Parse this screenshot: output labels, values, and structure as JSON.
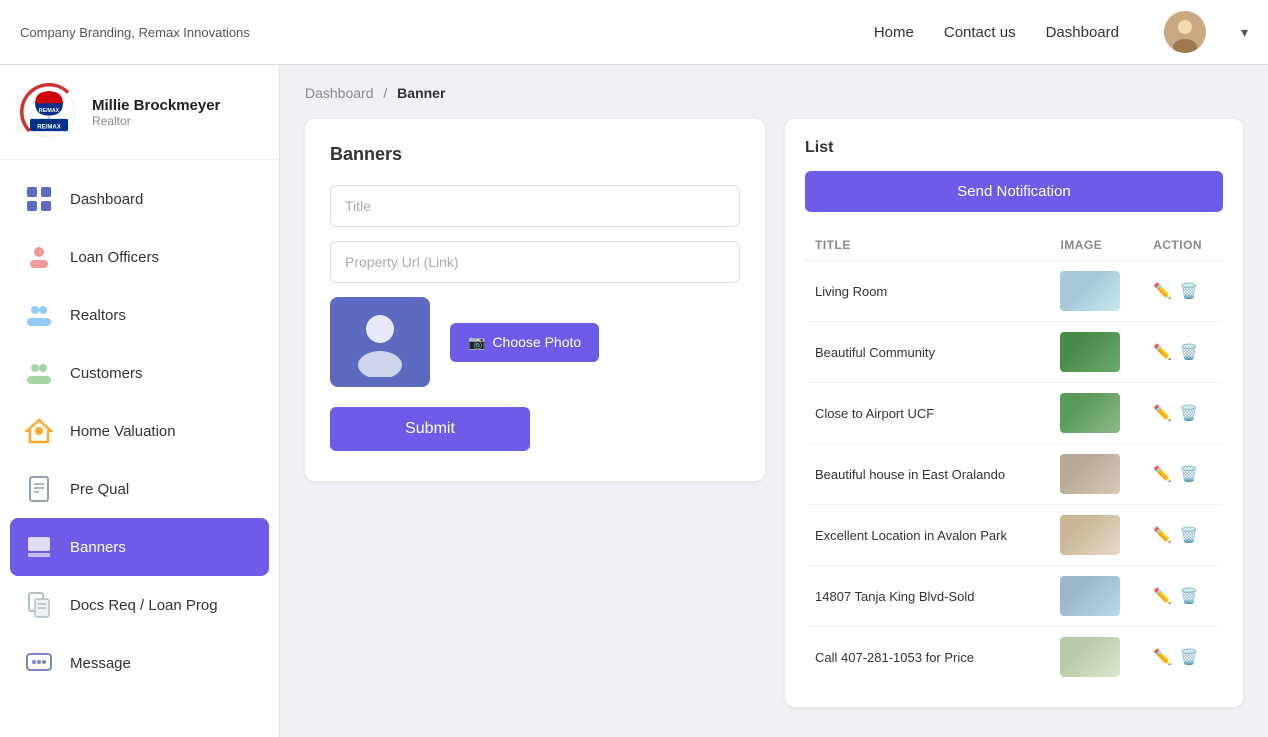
{
  "topnav": {
    "brand": "Company Branding, Remax Innovations",
    "links": [
      "Home",
      "Contact us",
      "Dashboard"
    ],
    "dropdown_arrow": "▾"
  },
  "sidebar": {
    "user_name": "Millie Brockmeyer",
    "user_role": "Realtor",
    "items": [
      {
        "id": "dashboard",
        "label": "Dashboard",
        "icon": "🖥️"
      },
      {
        "id": "loan-officers",
        "label": "Loan Officers",
        "icon": "👤"
      },
      {
        "id": "realtors",
        "label": "Realtors",
        "icon": "👥"
      },
      {
        "id": "customers",
        "label": "Customers",
        "icon": "👥"
      },
      {
        "id": "home-valuation",
        "label": "Home Valuation",
        "icon": "🏠"
      },
      {
        "id": "pre-qual",
        "label": "Pre Qual",
        "icon": "📄"
      },
      {
        "id": "banners",
        "label": "Banners",
        "icon": "🟪",
        "active": true
      },
      {
        "id": "docs-req",
        "label": "Docs Req / Loan Prog",
        "icon": "📋"
      },
      {
        "id": "message",
        "label": "Message",
        "icon": "💬"
      }
    ]
  },
  "breadcrumb": {
    "root": "Dashboard",
    "sep": "/",
    "current": "Banner"
  },
  "banners_form": {
    "title": "Banners",
    "title_placeholder": "Title",
    "url_placeholder": "Property Url (Link)",
    "choose_photo_label": "Choose Photo",
    "submit_label": "Submit"
  },
  "list_panel": {
    "title": "List",
    "send_notification_label": "Send Notification",
    "table_headers": [
      "TITLE",
      "IMAGE",
      "ACTION"
    ],
    "rows": [
      {
        "title": "Living Room",
        "thumb_class": "thumb-1"
      },
      {
        "title": "Beautiful Community",
        "thumb_class": "thumb-2"
      },
      {
        "title": "Close to Airport UCF",
        "thumb_class": "thumb-3"
      },
      {
        "title": "Beautiful house in East Oralando",
        "thumb_class": "thumb-4"
      },
      {
        "title": "Excellent Location in Avalon Park",
        "thumb_class": "thumb-5"
      },
      {
        "title": "14807 Tanja King Blvd-Sold",
        "thumb_class": "thumb-6"
      },
      {
        "title": "Call 407-281-1053 for Price",
        "thumb_class": "thumb-7"
      }
    ]
  }
}
